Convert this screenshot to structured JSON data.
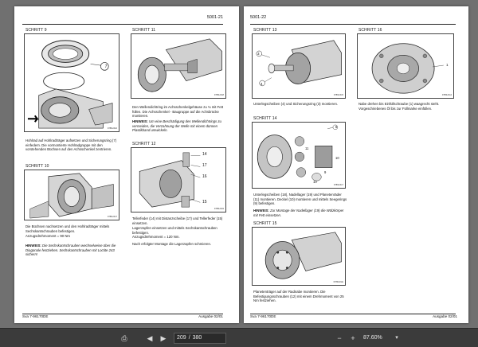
{
  "left_page": {
    "page_number": "5001-21",
    "step9": {
      "title": "SCHRITT 9",
      "callout": "7",
      "fig_code": "0789L0G0",
      "text": "Hohlrad auf Hohlradträger aufsetzen und Sicherungsring (7) einfedern. Die vormontierte Hohlradgruppe mit den vorstehenden Büchsen auf den Achsschenkel zentrieren."
    },
    "step10": {
      "title": "SCHRITT 10",
      "fig_code": "0789L0G7",
      "text": "Die Büchsen nachsetzen und den Hohlradträger mittels Sechskantschrauben befestigen.",
      "torque": "Anzugsdrehmoment = 90 Nm",
      "note_label": "HINWEIS:",
      "note": "Die Sechskantschrauben wechselweise über die Diagonale festziehen. Sechskantschrauben mit Loctite 243 sichern!"
    },
    "step11": {
      "title": "SCHRITT 11",
      "fig_code": "0789L0G8",
      "text": "Den Wellendichtring im Achsschenkelgehäuse zu ⅓ mit Fett füllen. Die Achsschenkel - Baugruppe auf die Achsbrücke montieren.",
      "note_label": "HINWEIS:",
      "note": "Um eine Beschädigung des Wellendichtrings zu vermeiden, die Verzahnung der Welle mit einem dünnen Plastikband umwickeln."
    },
    "step12": {
      "title": "SCHRITT 12",
      "callouts": [
        "14",
        "17",
        "16",
        "15"
      ],
      "fig_code": "0789L0G9",
      "text": "Tellerfeder (14) mit Distanzscheibe (17) und Tellerfeder (15) einsetzen.",
      "text2": "Lagerzapfen einsetzen und mittels Sechskantschrauben befestigen.",
      "torque": "Anzugsdrehmoment = 120 Nm.",
      "text3": "Nach erfolgter Montage die Lagerzapfen schmieren."
    },
    "footer_left": "Sva 7-96170DE",
    "footer_right": "Ausgabe 02/01"
  },
  "right_page": {
    "page_number": "5001-22",
    "step13": {
      "title": "SCHRITT 13",
      "callouts": [
        "3",
        "4"
      ],
      "fig_code": "0789L0G5",
      "text": "Unterlegscheiben (4) und Sicherungsring (3) montieren."
    },
    "step14": {
      "title": "SCHRITT 14",
      "callouts": [
        "8",
        "11",
        "10",
        "9",
        "10"
      ],
      "fig_code": "0789L0G7",
      "text": "Unterlegscheiben (18), Nadellager (19) und Planetenräder (11) montieren. Deckel (10) montieren und mittels Seegerings (9) befestigen.",
      "note_label": "HINWEIS:",
      "note": "Zur Montage der Nadellager (19) die Wälzkörper mit Fett einsetzen."
    },
    "step15": {
      "title": "SCHRITT 15",
      "fig_code": "0789L0GE",
      "text": "Planetenträger auf der Radnabe montieren. Die Befestigungsschrauben (12) mit einem Drehmoment von 25 Nm festziehen."
    },
    "step16": {
      "title": "SCHRITT 16",
      "callout": "1",
      "fig_code": "0789L0G4",
      "text": "Nabe drehen bis Einfüllschraube (1) waagrecht steht. Vorgeschriebenes Öl bis zur Füllmarke einfüllen."
    },
    "footer_left": "Sva 7-96170DE",
    "footer_right": "Ausgabe 02/01"
  },
  "toolbar": {
    "current_page": "209",
    "separator": "/",
    "total_pages": "380",
    "zoom": "87.60%",
    "icons": [
      "print-icon",
      "prev-page-icon",
      "next-page-icon",
      "zoom-out-icon",
      "zoom-in-icon",
      "chevron-down-icon"
    ]
  }
}
